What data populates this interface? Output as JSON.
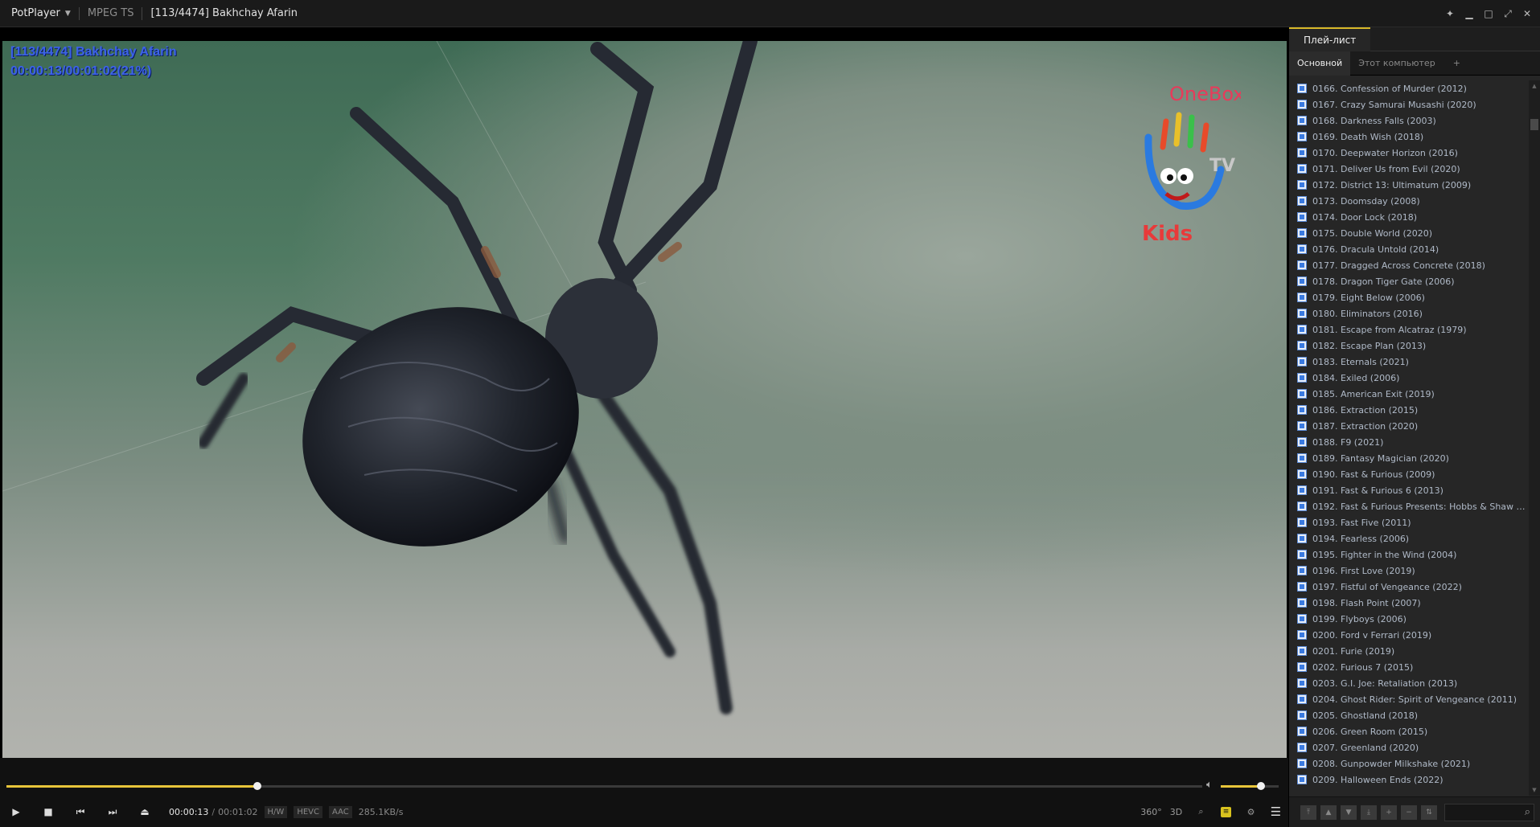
{
  "titlebar": {
    "app_name": "PotPlayer",
    "format": "MPEG TS",
    "title": "[113/4474] Bakhchay Afarin"
  },
  "osd": {
    "line1": "[113/4474] Bakhchay Afarin",
    "line2": "00:00:13/00:01:02(21%)"
  },
  "logo": {
    "brand": "OneBox",
    "tv": "TV",
    "kids": "Kids"
  },
  "player": {
    "progress": 0.21,
    "volume_fraction": 0.69,
    "time_current": "00:00:13",
    "time_separator": "/",
    "time_duration": "00:01:02",
    "hw": "H/W",
    "video_codec": "HEVC",
    "audio_codec": "AAC",
    "bitrate": "285.1KB/s",
    "btn_360": "360°",
    "btn_3d": "3D"
  },
  "playlist": {
    "tab_label": "Плей-лист",
    "subtabs": [
      "Основной",
      "Этот компьютер",
      "+"
    ],
    "items": [
      "0166. Confession of Murder (2012)",
      "0167. Crazy Samurai Musashi (2020)",
      "0168. Darkness Falls (2003)",
      "0169. Death Wish (2018)",
      "0170. Deepwater Horizon (2016)",
      "0171. Deliver Us from Evil (2020)",
      "0172. District 13: Ultimatum (2009)",
      "0173. Doomsday (2008)",
      "0174. Door Lock (2018)",
      "0175. Double World (2020)",
      "0176. Dracula Untold (2014)",
      "0177. Dragged Across Concrete (2018)",
      "0178. Dragon Tiger Gate (2006)",
      "0179. Eight Below (2006)",
      "0180. Eliminators (2016)",
      "0181. Escape from Alcatraz (1979)",
      "0182. Escape Plan (2013)",
      "0183. Eternals (2021)",
      "0184. Exiled (2006)",
      "0185. American Exit (2019)",
      "0186. Extraction (2015)",
      "0187. Extraction (2020)",
      "0188. F9 (2021)",
      "0189. Fantasy Magician (2020)",
      "0190. Fast & Furious (2009)",
      "0191. Fast & Furious 6 (2013)",
      "0192. Fast & Furious Presents: Hobbs & Shaw (...",
      "0193. Fast Five (2011)",
      "0194. Fearless (2006)",
      "0195. Fighter in the Wind (2004)",
      "0196. First Love (2019)",
      "0197. Fistful of Vengeance (2022)",
      "0198. Flash Point (2007)",
      "0199. Flyboys (2006)",
      "0200. Ford v Ferrari (2019)",
      "0201. Furie (2019)",
      "0202. Furious 7 (2015)",
      "0203. G.I. Joe: Retaliation (2013)",
      "0204. Ghost Rider: Spirit of Vengeance (2011)",
      "0205. Ghostland (2018)",
      "0206. Green Room (2015)",
      "0207. Greenland (2020)",
      "0208. Gunpowder Milkshake (2021)",
      "0209. Halloween Ends (2022)"
    ]
  },
  "colors": {
    "accent": "#e8c53a",
    "osd_text": "#3c62e8",
    "playlist_text": "#b0bac8"
  }
}
